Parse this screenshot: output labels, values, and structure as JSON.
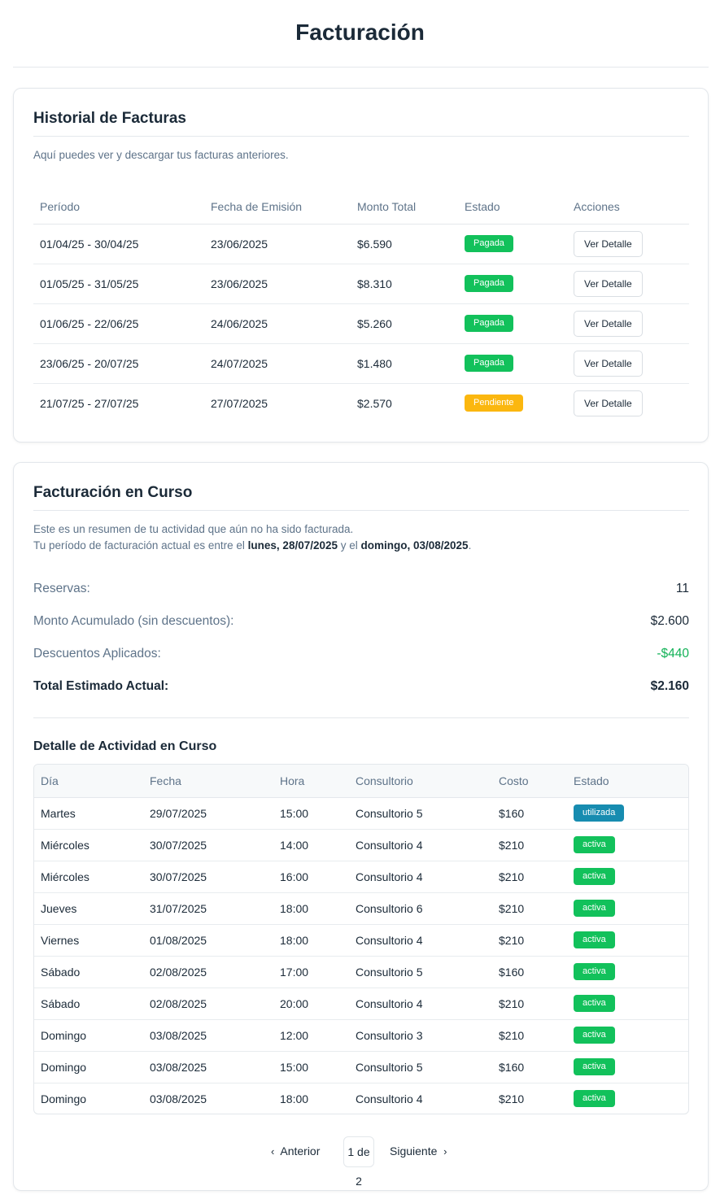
{
  "page": {
    "title": "Facturación"
  },
  "history": {
    "title": "Historial de Facturas",
    "subtitle": "Aquí puedes ver y descargar tus facturas anteriores.",
    "columns": [
      "Período",
      "Fecha de Emisión",
      "Monto Total",
      "Estado",
      "Acciones"
    ],
    "action_label": "Ver Detalle",
    "rows": [
      {
        "period": "01/04/25 - 30/04/25",
        "issued": "23/06/2025",
        "amount": "$6.590",
        "status": "Pagada",
        "status_kind": "paid"
      },
      {
        "period": "01/05/25 - 31/05/25",
        "issued": "23/06/2025",
        "amount": "$8.310",
        "status": "Pagada",
        "status_kind": "paid"
      },
      {
        "period": "01/06/25 - 22/06/25",
        "issued": "24/06/2025",
        "amount": "$5.260",
        "status": "Pagada",
        "status_kind": "paid"
      },
      {
        "period": "23/06/25 - 20/07/25",
        "issued": "24/07/2025",
        "amount": "$1.480",
        "status": "Pagada",
        "status_kind": "paid"
      },
      {
        "period": "21/07/25 - 27/07/25",
        "issued": "27/07/2025",
        "amount": "$2.570",
        "status": "Pendiente",
        "status_kind": "pending"
      }
    ]
  },
  "current": {
    "title": "Facturación en Curso",
    "intro_line1": "Este es un resumen de tu actividad que aún no ha sido facturada.",
    "intro_line2_prefix": "Tu período de facturación actual es entre el ",
    "period_start": "lunes, 28/07/2025",
    "intro_line2_mid": " y el ",
    "period_end": "domingo, 03/08/2025",
    "intro_line2_suffix": ".",
    "summary": {
      "bookings_label": "Reservas:",
      "bookings_value": "11",
      "accumulated_label": "Monto Acumulado (sin descuentos):",
      "accumulated_value": "$2.600",
      "discounts_label": "Descuentos Aplicados:",
      "discounts_value": "-$440",
      "total_label": "Total Estimado Actual:",
      "total_value": "$2.160"
    },
    "activity_title": "Detalle de Actividad en Curso",
    "activity_columns": [
      "Día",
      "Fecha",
      "Hora",
      "Consultorio",
      "Costo",
      "Estado"
    ],
    "activity_rows": [
      {
        "day": "Martes",
        "date": "29/07/2025",
        "time": "15:00",
        "office": "Consultorio 5",
        "cost": "$160",
        "status": "utilizada",
        "status_kind": "used"
      },
      {
        "day": "Miércoles",
        "date": "30/07/2025",
        "time": "14:00",
        "office": "Consultorio 4",
        "cost": "$210",
        "status": "activa",
        "status_kind": "active"
      },
      {
        "day": "Miércoles",
        "date": "30/07/2025",
        "time": "16:00",
        "office": "Consultorio 4",
        "cost": "$210",
        "status": "activa",
        "status_kind": "active"
      },
      {
        "day": "Jueves",
        "date": "31/07/2025",
        "time": "18:00",
        "office": "Consultorio 6",
        "cost": "$210",
        "status": "activa",
        "status_kind": "active"
      },
      {
        "day": "Viernes",
        "date": "01/08/2025",
        "time": "18:00",
        "office": "Consultorio 4",
        "cost": "$210",
        "status": "activa",
        "status_kind": "active"
      },
      {
        "day": "Sábado",
        "date": "02/08/2025",
        "time": "17:00",
        "office": "Consultorio 5",
        "cost": "$160",
        "status": "activa",
        "status_kind": "active"
      },
      {
        "day": "Sábado",
        "date": "02/08/2025",
        "time": "20:00",
        "office": "Consultorio 4",
        "cost": "$210",
        "status": "activa",
        "status_kind": "active"
      },
      {
        "day": "Domingo",
        "date": "03/08/2025",
        "time": "12:00",
        "office": "Consultorio 3",
        "cost": "$210",
        "status": "activa",
        "status_kind": "active"
      },
      {
        "day": "Domingo",
        "date": "03/08/2025",
        "time": "15:00",
        "office": "Consultorio 5",
        "cost": "$160",
        "status": "activa",
        "status_kind": "active"
      },
      {
        "day": "Domingo",
        "date": "03/08/2025",
        "time": "18:00",
        "office": "Consultorio 4",
        "cost": "$210",
        "status": "activa",
        "status_kind": "active"
      }
    ],
    "pagination": {
      "prev_label": "Anterior",
      "page_label": "1 de 2",
      "next_label": "Siguiente"
    }
  },
  "colors": {
    "paid": "#12c15b",
    "pending": "#fbb70f",
    "used": "#178cb0",
    "active": "#12c15b",
    "discount": "#12b257"
  },
  "icons": {
    "prev": "chevron-left-icon",
    "next": "chevron-right-icon"
  }
}
